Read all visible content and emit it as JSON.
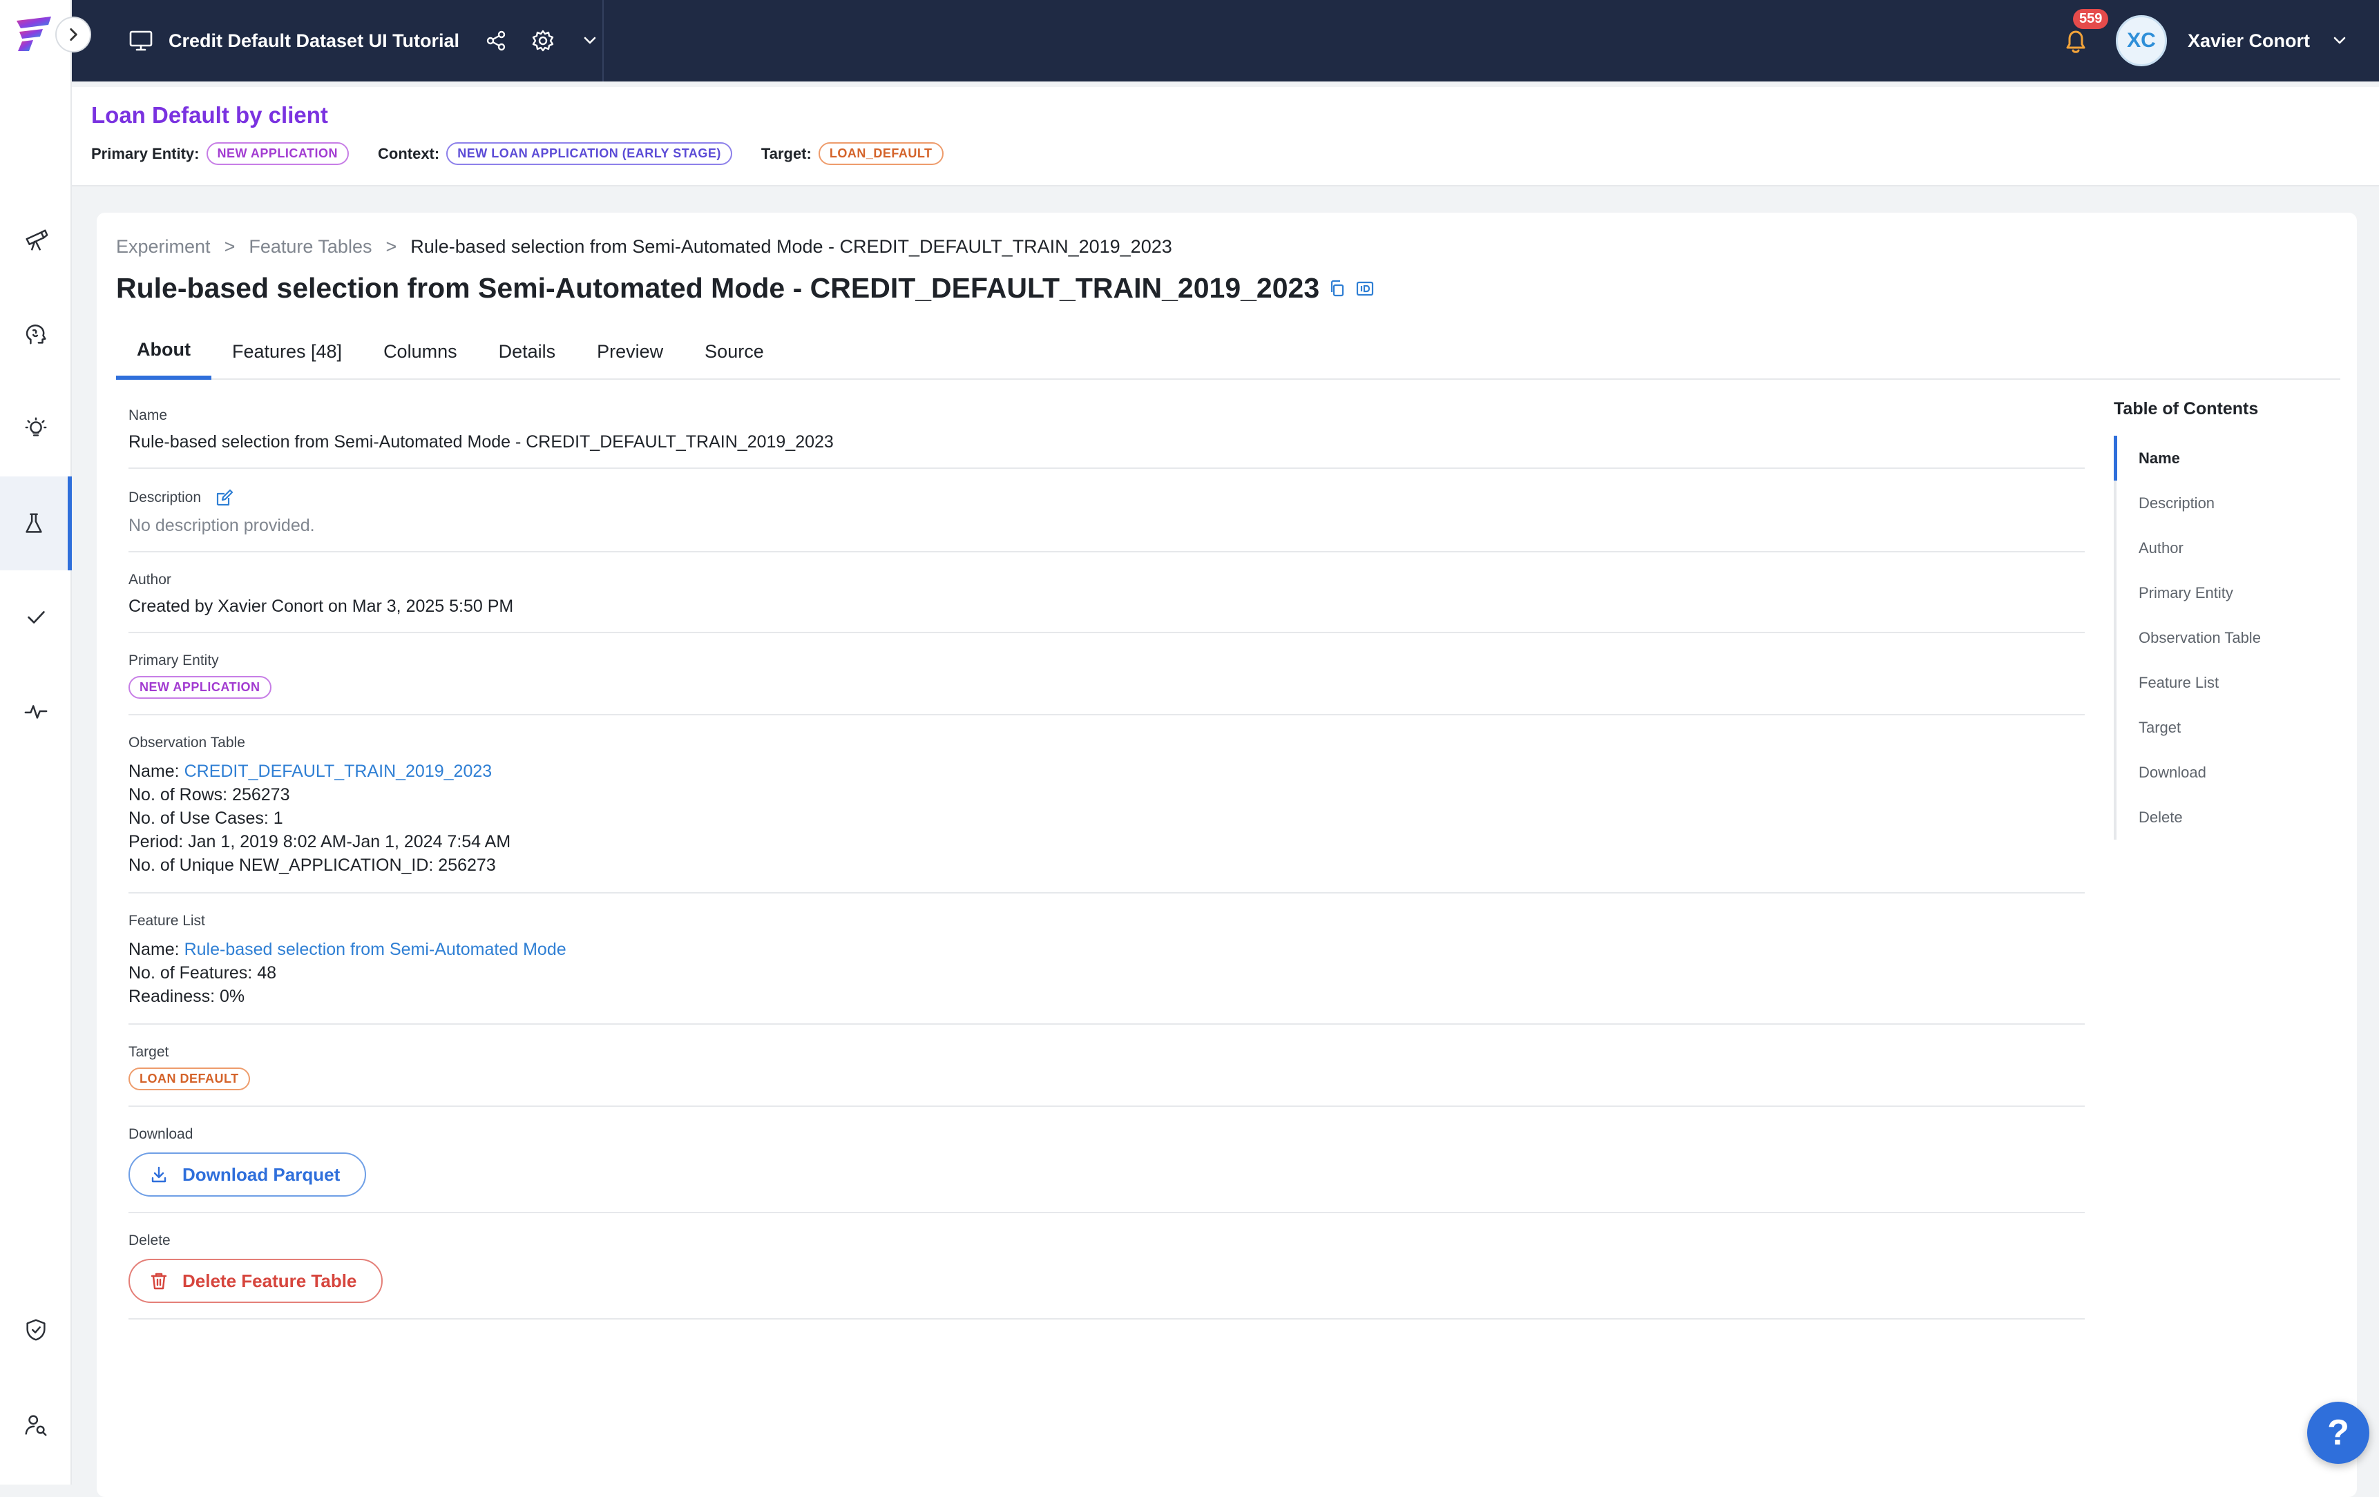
{
  "topbar": {
    "project_title": "Credit Default Dataset UI Tutorial",
    "notifications_count": "559",
    "avatar_initials": "XC",
    "user_name": "Xavier Conort"
  },
  "catalog": {
    "title": "Loan Default by client",
    "primary_entity_label": "Primary Entity:",
    "primary_entity": "NEW APPLICATION",
    "context_label": "Context:",
    "context": "NEW LOAN APPLICATION (EARLY STAGE)",
    "target_label": "Target:",
    "target": "LOAN_DEFAULT"
  },
  "breadcrumb": {
    "items": [
      "Experiment",
      "Feature Tables"
    ],
    "separator": ">",
    "current": "Rule-based selection from Semi-Automated Mode - CREDIT_DEFAULT_TRAIN_2019_2023"
  },
  "page_title": "Rule-based selection from Semi-Automated Mode - CREDIT_DEFAULT_TRAIN_2019_2023",
  "tabs": [
    "About",
    "Features [48]",
    "Columns",
    "Details",
    "Preview",
    "Source"
  ],
  "about": {
    "name": {
      "label": "Name",
      "value": "Rule-based selection from Semi-Automated Mode - CREDIT_DEFAULT_TRAIN_2019_2023"
    },
    "description": {
      "label": "Description",
      "value": "No description provided."
    },
    "author": {
      "label": "Author",
      "value": "Created by Xavier Conort on Mar 3, 2025 5:50 PM"
    },
    "primary_entity": {
      "label": "Primary Entity",
      "value": "NEW APPLICATION"
    },
    "observation_table": {
      "label": "Observation Table",
      "name_key": "Name:",
      "name_value": "CREDIT_DEFAULT_TRAIN_2019_2023",
      "rows": "No. of Rows: 256273",
      "use_cases": "No. of Use Cases: 1",
      "period": "Period: Jan 1, 2019 8:02 AM-Jan 1, 2024 7:54 AM",
      "unique": "No. of Unique NEW_APPLICATION_ID: 256273"
    },
    "feature_list": {
      "label": "Feature List",
      "name_key": "Name:",
      "name_value": "Rule-based selection from Semi-Automated Mode",
      "features": "No. of Features: 48",
      "readiness": "Readiness: 0%"
    },
    "target": {
      "label": "Target",
      "value": "LOAN DEFAULT"
    },
    "download": {
      "label": "Download",
      "button": "Download Parquet"
    },
    "delete": {
      "label": "Delete",
      "button": "Delete Feature Table"
    }
  },
  "toc": {
    "title": "Table of Contents",
    "items": [
      "Name",
      "Description",
      "Author",
      "Primary Entity",
      "Observation Table",
      "Feature List",
      "Target",
      "Download",
      "Delete"
    ]
  },
  "help_label": "?",
  "colors": {
    "topbar": "#1f2a44",
    "accent": "#2f6fdb",
    "catalog_title": "#7a32e0",
    "entity_pill": "#a23bd1",
    "context_pill": "#5b4bd6",
    "target_pill": "#d4632a",
    "danger": "#d6453d"
  },
  "icons": {
    "rail": [
      "telescope-icon",
      "brain-icon",
      "lightbulb-icon",
      "flask-icon",
      "check-icon",
      "pulse-icon",
      "shield-icon",
      "user-search-icon"
    ],
    "topbar": [
      "monitor-icon",
      "share-icon",
      "gear-icon",
      "chevron-down-icon",
      "bell-icon"
    ]
  }
}
